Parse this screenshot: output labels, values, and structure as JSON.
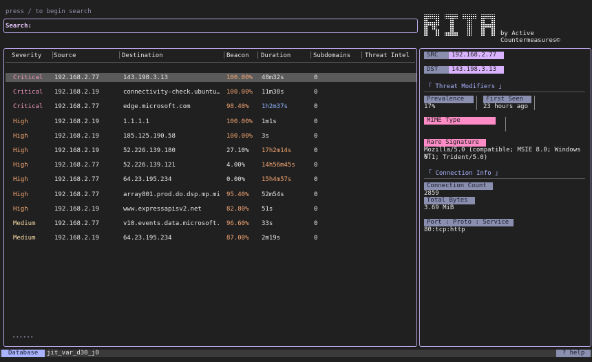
{
  "search": {
    "hint": "press / to begin search",
    "label": "Search:",
    "value": ""
  },
  "brand": {
    "logo": "RITA",
    "byline": "by Active Countermeasures©"
  },
  "table": {
    "headers": [
      "Severity",
      "Source",
      "Destination",
      "Beacon",
      "Duration",
      "Subdomains",
      "Threat Intel"
    ],
    "rows": [
      {
        "severity": "Critical",
        "source": "192.168.2.77",
        "destination": "143.198.3.13",
        "beacon": "100.00%",
        "duration": "48m32s",
        "subdomains": "0",
        "selected": true
      },
      {
        "severity": "Critical",
        "source": "192.168.2.19",
        "destination": "connectivity-check.ubuntu…",
        "beacon": "100.00%",
        "duration": "11m38s",
        "subdomains": "0"
      },
      {
        "severity": "Critical",
        "source": "192.168.2.77",
        "destination": "edge.microsoft.com",
        "beacon": "98.40%",
        "duration": "1h2m37s",
        "subdomains": "0"
      },
      {
        "severity": "High",
        "source": "192.168.2.19",
        "destination": "1.1.1.1",
        "beacon": "100.00%",
        "duration": "1m1s",
        "subdomains": "0"
      },
      {
        "severity": "High",
        "source": "192.168.2.19",
        "destination": "185.125.190.58",
        "beacon": "100.00%",
        "duration": "3s",
        "subdomains": "0"
      },
      {
        "severity": "High",
        "source": "192.168.2.19",
        "destination": "52.226.139.180",
        "beacon": "27.10%",
        "duration": "17h2m14s",
        "subdomains": "0"
      },
      {
        "severity": "High",
        "source": "192.168.2.77",
        "destination": "52.226.139.121",
        "beacon": "4.00%",
        "duration": "14h56m45s",
        "subdomains": "0"
      },
      {
        "severity": "High",
        "source": "192.168.2.77",
        "destination": "64.23.195.234",
        "beacon": "0.00%",
        "duration": "15h4m57s",
        "subdomains": "0"
      },
      {
        "severity": "High",
        "source": "192.168.2.77",
        "destination": "array801.prod.do.dsp.mp.mi…",
        "beacon": "95.40%",
        "duration": "52m54s",
        "subdomains": "0"
      },
      {
        "severity": "High",
        "source": "192.168.2.19",
        "destination": "www.expressapisv2.net",
        "beacon": "82.80%",
        "duration": "51s",
        "subdomains": "0"
      },
      {
        "severity": "Medium",
        "source": "192.168.2.77",
        "destination": "v10.events.data.microsoft.…",
        "beacon": "96.60%",
        "duration": "33s",
        "subdomains": "0"
      },
      {
        "severity": "Medium",
        "source": "192.168.2.19",
        "destination": "64.23.195.234",
        "beacon": "87.00%",
        "duration": "2m19s",
        "subdomains": "0"
      }
    ],
    "pagination": "••••••"
  },
  "details": {
    "src_label": "SRC",
    "src_value": "192.168.2.77",
    "dst_label": "DST",
    "dst_value": "143.198.3.13",
    "threat_modifiers_title": "「 Threat Modifiers 」",
    "prevalence_label": "Prevalence",
    "prevalence_value": "17%",
    "first_seen_label": "First Seen",
    "first_seen_value": "23 hours ago",
    "mime_label": "MIME Type Mismatch",
    "rare_sig_label": "Rare Signature",
    "rare_sig_value_1": "Mozilla/5.0 (compatible; MSIE 8.0; Windows NT",
    "rare_sig_value_2": "6.1; Trident/5.0)",
    "connection_info_title": "「 Connection Info 」",
    "conn_count_label": "Connection Count",
    "conn_count_value": "2859",
    "total_bytes_label": "Total Bytes",
    "total_bytes_value": "3.69 MiB",
    "port_label": "Port : Proto : Service",
    "port_value": "80:tcp:http"
  },
  "statusbar": {
    "db_label": "Database",
    "db_name": "jit_var_d30_j0",
    "help": "? help"
  },
  "colors": {
    "accent": "#b8a6e6",
    "critical": "#f39bc1",
    "high": "#f6a774",
    "medium": "#f5d8a4",
    "blue": "#8fb6ff",
    "pink_tag": "#ff8cc6"
  }
}
